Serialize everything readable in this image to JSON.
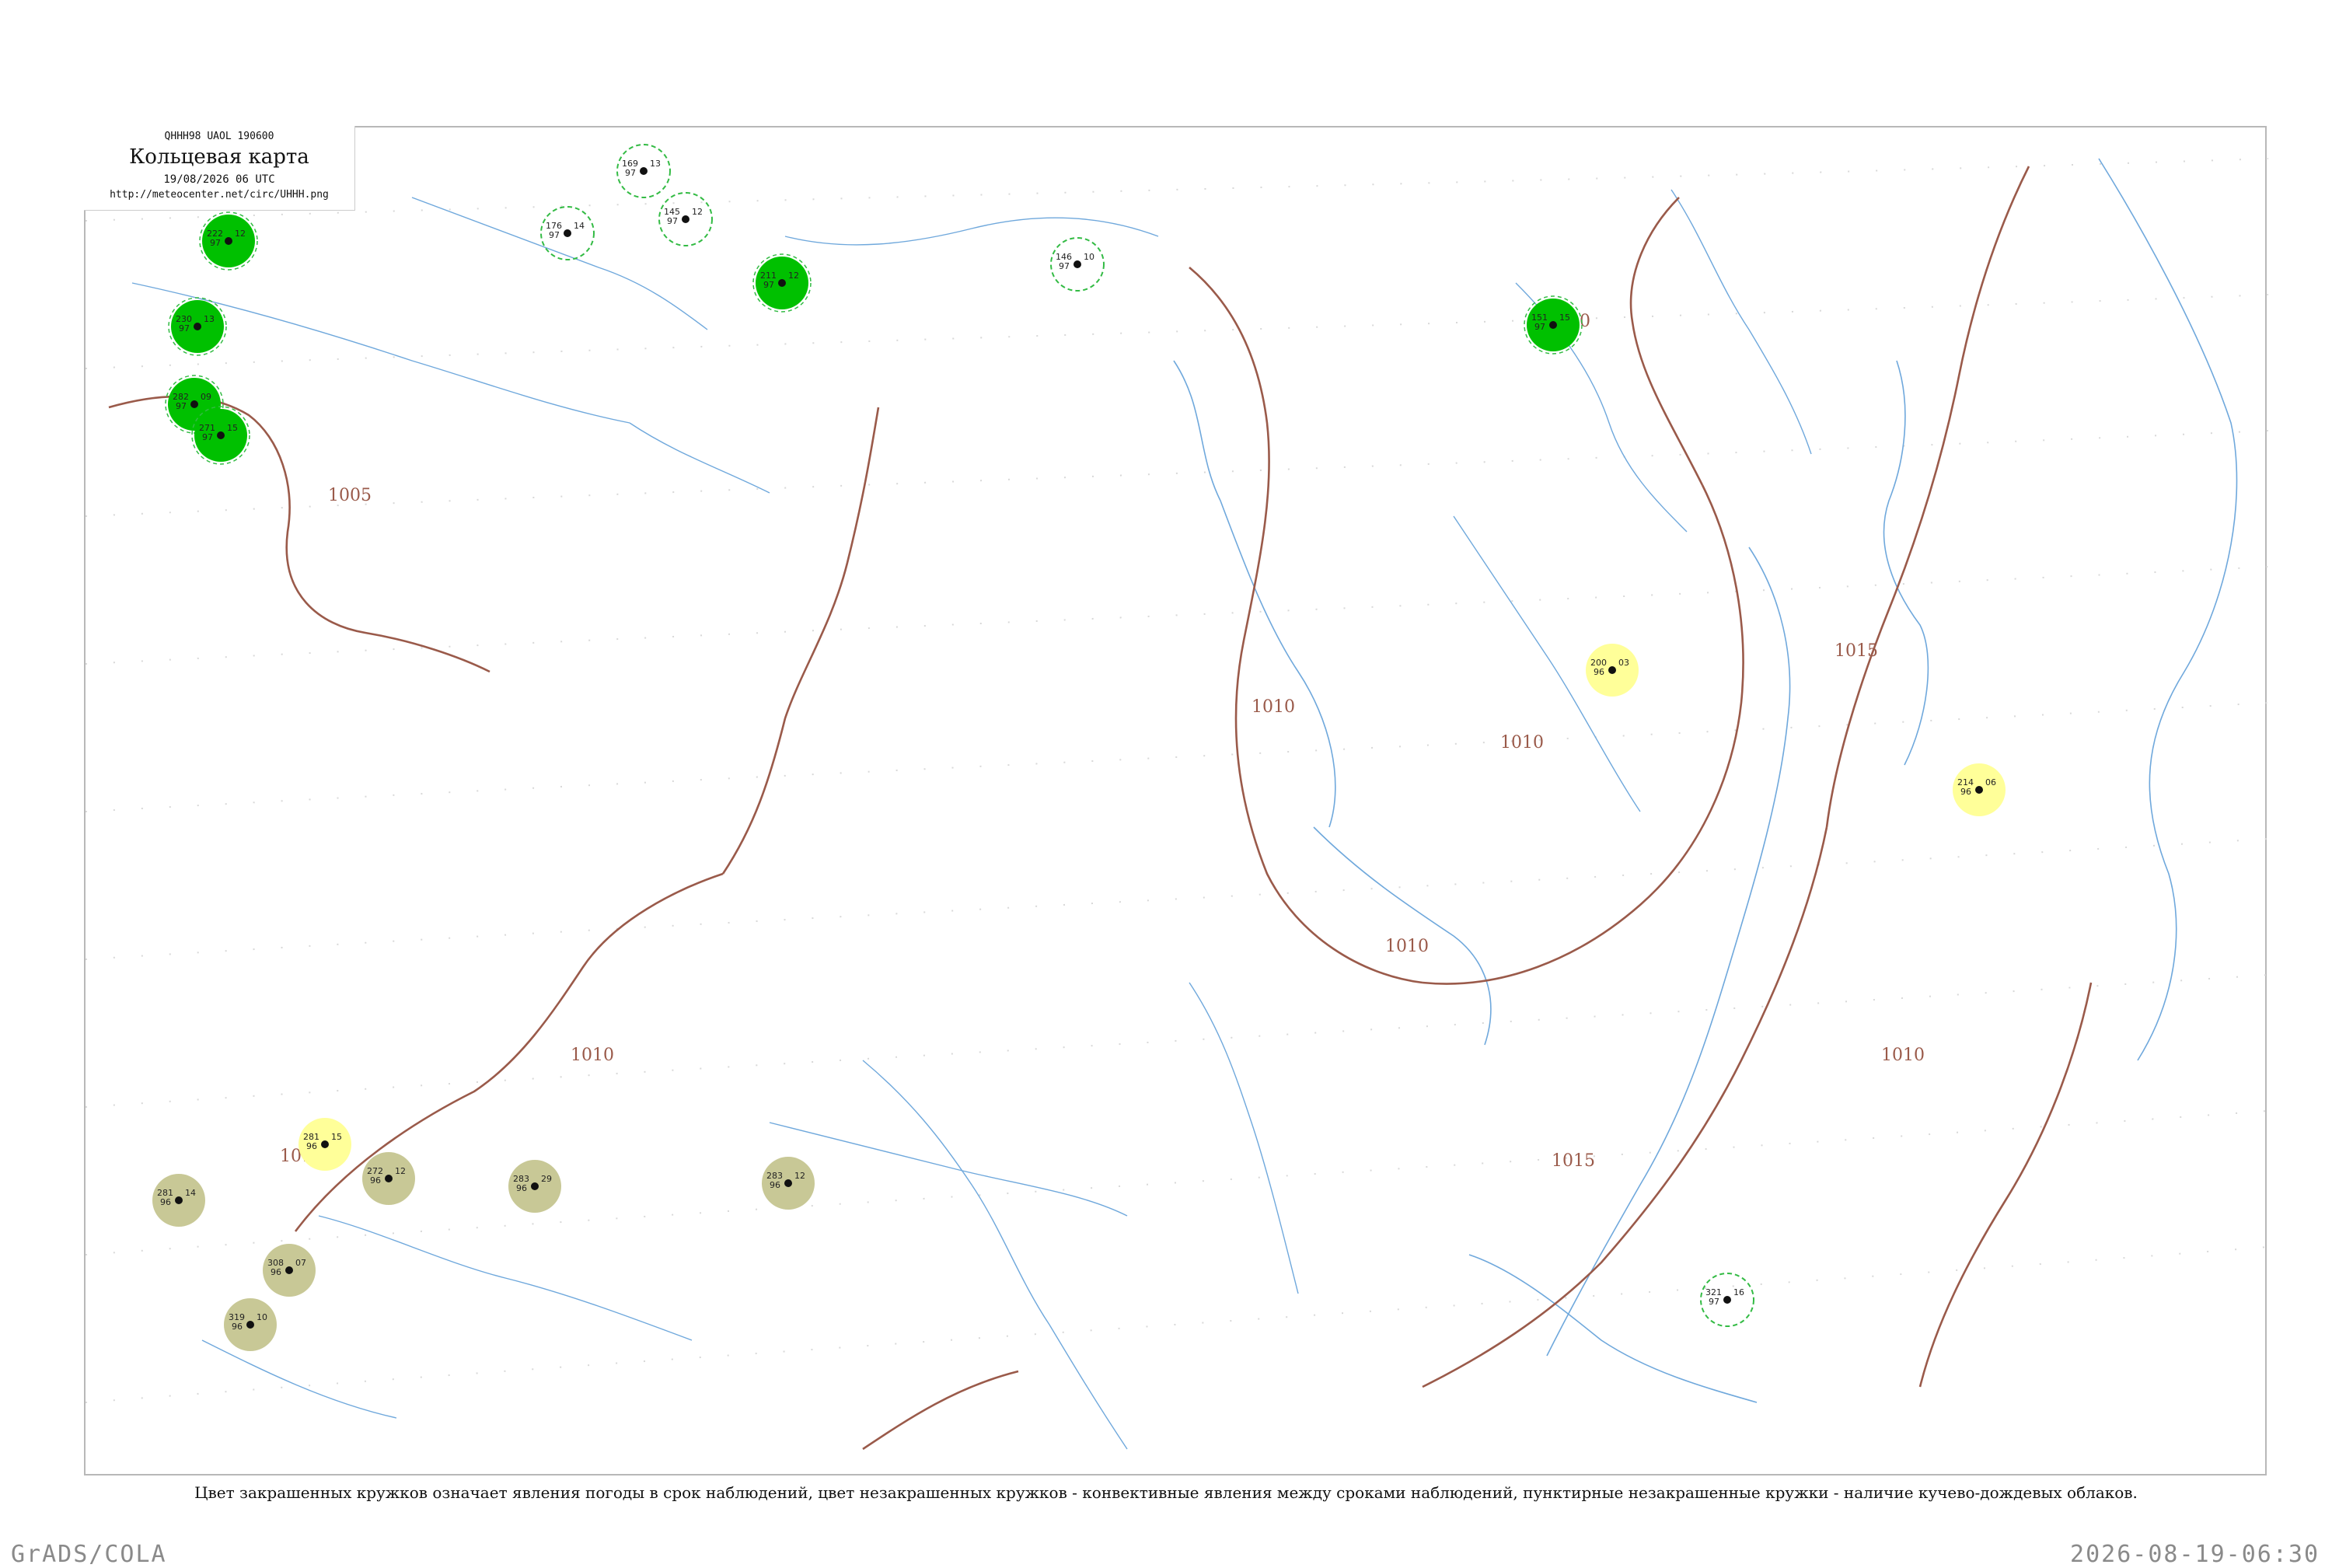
{
  "title_box": {
    "header": "QHHH98  UAOL  190600",
    "main": "Кольцевая карта",
    "time": "19/08/2026 06 UTC",
    "url": "http://meteocenter.net/circ/UHHH.png"
  },
  "caption": "Цвет закрашенных кружков означает явления погоды в срок наблюдений, цвет незакрашенных кружков - конвективные явления между сроками наблюдений, пунктирные незакрашенные кружки - наличие кучево-дождевых облаков.",
  "footer": {
    "left": "GrADS/COLA",
    "right": "2026-08-19-06:30"
  },
  "colors": {
    "isobar": "#9a5a4a",
    "river": "#6fa8dc",
    "rain_fill": "#00c000",
    "fog_fill": "#c8c896",
    "haze_fill": "#ffff99",
    "cb_dash": "#33bb44"
  },
  "isobar_labels": [
    {
      "id": "iso-1005",
      "text": "1005"
    },
    {
      "id": "iso-1010-a",
      "text": "1010"
    },
    {
      "id": "iso-1010-b",
      "text": "1010"
    },
    {
      "id": "iso-1010-c",
      "text": "1010"
    },
    {
      "id": "iso-1010-d",
      "text": "1010"
    },
    {
      "id": "iso-1010-e",
      "text": "1010"
    },
    {
      "id": "iso-1010-f",
      "text": "1010"
    },
    {
      "id": "iso-1010-g",
      "text": "1010"
    },
    {
      "id": "iso-1015-a",
      "text": "1015"
    },
    {
      "id": "iso-1015-b",
      "text": "1015"
    }
  ],
  "stations": [
    {
      "t": "222",
      "p": "97",
      "td": "12",
      "ww": "rain"
    },
    {
      "t": "230",
      "p": "97",
      "td": "13",
      "ww": "rain"
    },
    {
      "t": "282",
      "p": "97",
      "td": "09",
      "ww": "rain"
    },
    {
      "t": "271",
      "p": "97",
      "td": "15",
      "ww": "rain"
    },
    {
      "t": "211",
      "p": "97",
      "td": "12",
      "ww": "rain"
    },
    {
      "t": "176",
      "p": "97",
      "td": "14",
      "ww": "cb"
    },
    {
      "t": "169",
      "p": "97",
      "td": "13",
      "ww": "cb"
    },
    {
      "t": "145",
      "p": "97",
      "td": "12",
      "ww": "cb"
    },
    {
      "t": "151",
      "p": "97",
      "td": "15",
      "ww": "rain"
    },
    {
      "t": "146",
      "p": "97",
      "td": "10",
      "ww": "cb"
    },
    {
      "t": "200",
      "p": "96",
      "td": "03",
      "ww": "haze"
    },
    {
      "t": "214",
      "p": "96",
      "td": "06",
      "ww": "haze"
    },
    {
      "t": "281",
      "p": "96",
      "td": "15",
      "ww": "haze"
    },
    {
      "t": "281",
      "p": "96",
      "td": "14",
      "ww": "fog"
    },
    {
      "t": "272",
      "p": "96",
      "td": "12",
      "ww": "fog"
    },
    {
      "t": "308",
      "p": "96",
      "td": "07",
      "ww": "fog"
    },
    {
      "t": "319",
      "p": "96",
      "td": "10",
      "ww": "fog"
    },
    {
      "t": "283",
      "p": "96",
      "td": "12",
      "ww": "fog"
    },
    {
      "t": "283",
      "p": "96",
      "td": "29",
      "ww": "fog"
    },
    {
      "t": "321",
      "p": "97",
      "td": "16",
      "ww": "cb"
    }
  ]
}
